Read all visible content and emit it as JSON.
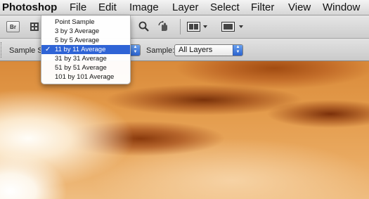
{
  "menubar": {
    "app_name": "Photoshop",
    "items": [
      "File",
      "Edit",
      "Image",
      "Layer",
      "Select",
      "Filter",
      "View",
      "Window"
    ]
  },
  "app_toolbar": {
    "bridge_button_label": "Br"
  },
  "options_bar": {
    "sample_size_label": "Sample Size:",
    "sample_label": "Sample:",
    "sample_value": "All Layers"
  },
  "sample_size_menu": {
    "selected_index": 3,
    "check_glyph": "✓",
    "items": [
      "Point Sample",
      "3 by 3 Average",
      "5 by 5 Average",
      "11 by 11 Average",
      "31 by 31 Average",
      "51 by 51 Average",
      "101 by 101 Average"
    ]
  }
}
